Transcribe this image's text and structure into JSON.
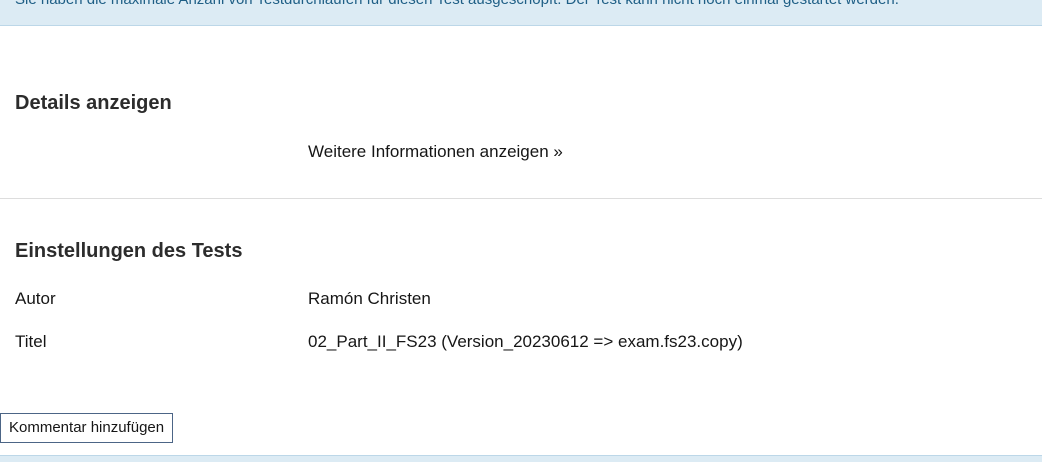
{
  "banner": {
    "text": "Sie haben die maximale Anzahl von Testdurchläufen für diesen Test ausgeschöpft. Der Test kann nicht noch einmal gestartet werden."
  },
  "details": {
    "heading": "Details anzeigen",
    "link_label": "Weitere Informationen anzeigen »"
  },
  "settings": {
    "heading": "Einstellungen des Tests",
    "rows": [
      {
        "label": "Autor",
        "value": "Ramón Christen"
      },
      {
        "label": "Titel",
        "value": "02_Part_II_FS23 (Version_20230612 => exam.fs23.copy)"
      }
    ]
  },
  "actions": {
    "comment_button_label": "Kommentar hinzufügen"
  }
}
